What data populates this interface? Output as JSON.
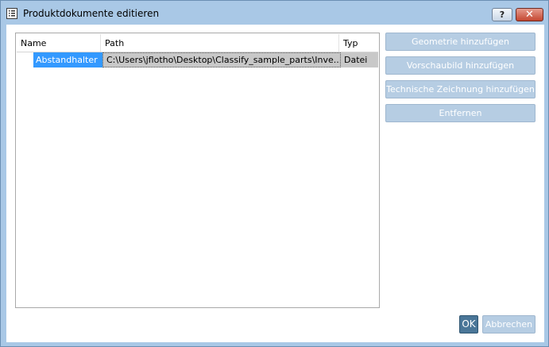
{
  "window": {
    "title": "Produktdokumente editieren",
    "help_label": "?",
    "close_label": "✕",
    "icon": "document-list-icon"
  },
  "table": {
    "columns": [
      "Name",
      "Path",
      "Typ"
    ],
    "rows": [
      {
        "name": "Abstandhalter",
        "path": "C:\\Users\\jflotho\\Desktop\\Classify_sample_parts\\Inve...",
        "typ": "Datei"
      }
    ]
  },
  "side_buttons": {
    "geometrie": "Geometrie hinzufügen",
    "vorschaubild": "Vorschaubild hinzufügen",
    "zeichnung": "Technische Zeichnung hinzufügen",
    "entfernen": "Entfernen"
  },
  "footer": {
    "ok": "OK",
    "abbrechen": "Abbrechen"
  },
  "colors": {
    "frame": "#a9c8e6",
    "selection": "#3399ff",
    "disabled_button": "#b6cde3",
    "ok_button": "#4a7698"
  }
}
